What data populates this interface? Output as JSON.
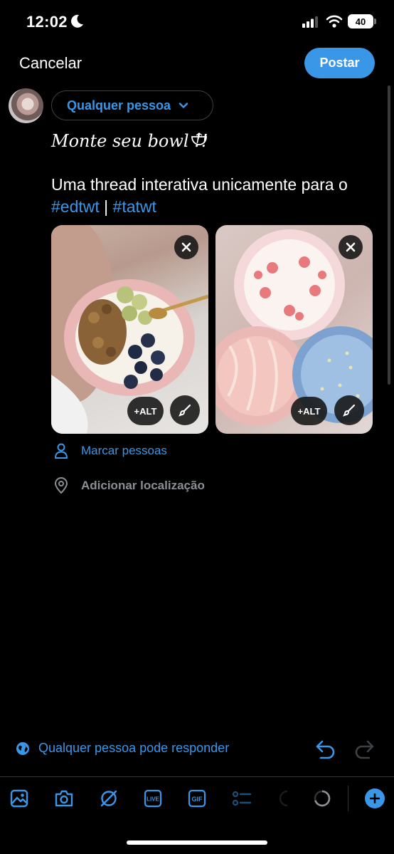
{
  "status_bar": {
    "time": "12:02",
    "battery": "40"
  },
  "header": {
    "cancel_label": "Cancelar",
    "post_label": "Postar"
  },
  "audience": {
    "label": "Qualquer pessoa"
  },
  "post": {
    "line1": "Monte seu bowl !!",
    "line2": "Uma thread interativa unicamente para o",
    "hashtag1": "#edtwt",
    "separator": " | ",
    "hashtag2": "#tatwt"
  },
  "media": [
    {
      "alt_label": "+ALT"
    },
    {
      "alt_label": "+ALT"
    }
  ],
  "actions": {
    "tag_people": "Marcar pessoas",
    "add_location": "Adicionar localização"
  },
  "reply_setting": {
    "label": "Qualquer pessoa pode responder"
  },
  "toolbar": {
    "live_label": "LIVE",
    "gif_label": "GIF"
  },
  "colors": {
    "accent": "#3a97e8",
    "background": "#000000",
    "text": "#ffffff",
    "muted": "#8b8f94"
  }
}
